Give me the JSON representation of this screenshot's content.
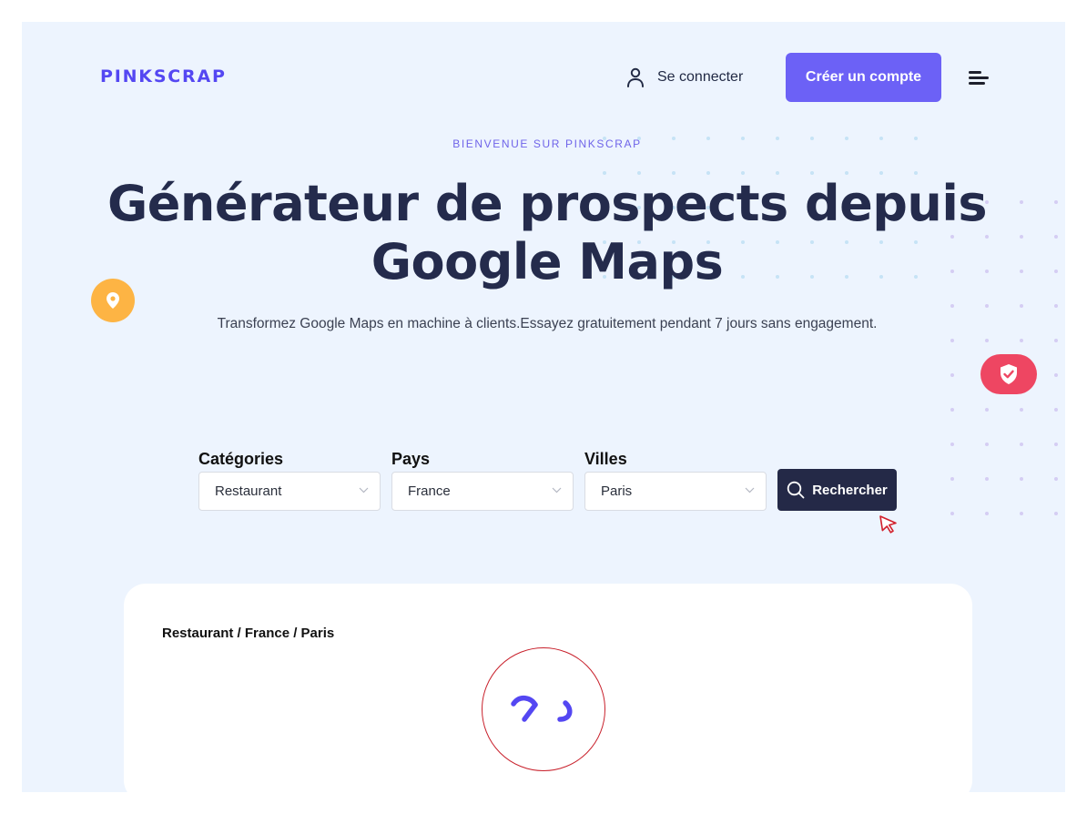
{
  "header": {
    "logo": "PINKSCRAP",
    "signin_label": "Se connecter",
    "signup_label": "Créer un compte"
  },
  "hero": {
    "eyebrow": "BIENVENUE SUR PINKSCRAP",
    "title_line1": "Générateur de prospects depuis",
    "title_line2": "Google Maps",
    "subtitle": "Transformez Google Maps en machine à clients.Essayez gratuitement pendant 7 jours sans engagement."
  },
  "search": {
    "categories": {
      "label": "Catégories",
      "value": "Restaurant"
    },
    "country": {
      "label": "Pays",
      "value": "France"
    },
    "cities": {
      "label": "Villes",
      "value": "Paris"
    },
    "button_label": "Rechercher"
  },
  "results": {
    "breadcrumb": "Restaurant / France / Paris"
  },
  "colors": {
    "brand": "#5447f2",
    "accent_button": "#6c61f6",
    "dark_navy": "#242947",
    "page_bg": "#edf4fe",
    "pin_bubble": "#fdb444",
    "shield_bubble": "#ee4662",
    "loader_ring": "#c8202b"
  },
  "icons": {
    "signin": "user-icon",
    "menu": "menu-icon",
    "pin": "map-pin-icon",
    "shield": "shield-check-icon",
    "search": "search-icon",
    "select": "chevron-down-icon",
    "cursor": "cursor-icon",
    "loader": "loading-icon"
  }
}
